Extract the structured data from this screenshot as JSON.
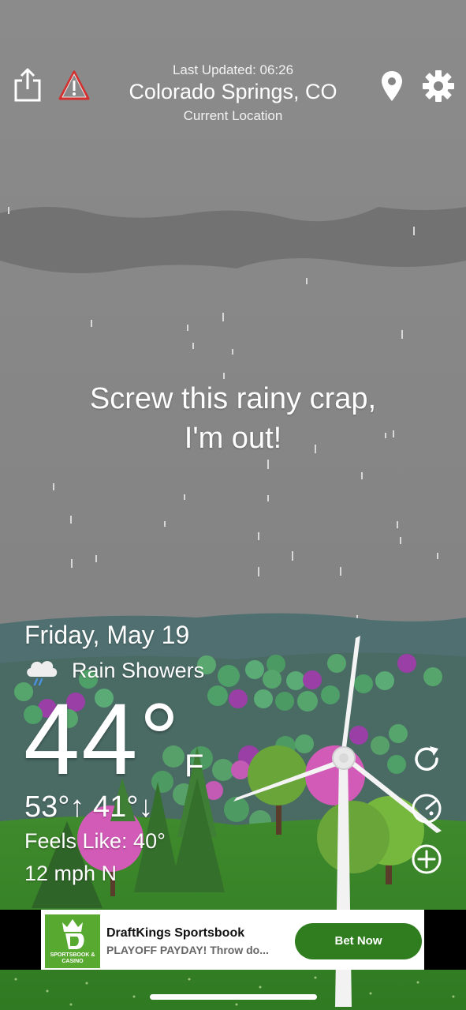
{
  "header": {
    "last_updated": "Last Updated: 06:26",
    "location": "Colorado Springs, CO",
    "location_sub": "Current Location",
    "icons": [
      "share-icon",
      "alert-icon",
      "location-pin-icon",
      "settings-gear-icon"
    ]
  },
  "quip": {
    "line1": "Screw this rainy crap,",
    "line2": "I'm out!"
  },
  "weather": {
    "date": "Friday, May 19",
    "condition": "Rain Showers",
    "condition_icon": "cloud-rain-icon",
    "temperature": "44°",
    "unit": "F",
    "high_low": "53°↑ 41°↓",
    "feels_like": "Feels Like: 40°",
    "wind": "12 mph N"
  },
  "side_buttons": [
    "refresh-icon",
    "radar-icon",
    "zoom-in-icon"
  ],
  "ad": {
    "logo_text": "SPORTSBOOK & CASINO",
    "title": "DraftKings Sportsbook",
    "subtitle": "PLAYOFF PAYDAY! Throw do...",
    "cta": "Bet Now"
  },
  "colors": {
    "sky": "#858585",
    "mountains": "#4e6e6e",
    "grass": "#3e8a2a",
    "ad_button": "#2f7d1f",
    "alert": "#d32f2f"
  }
}
